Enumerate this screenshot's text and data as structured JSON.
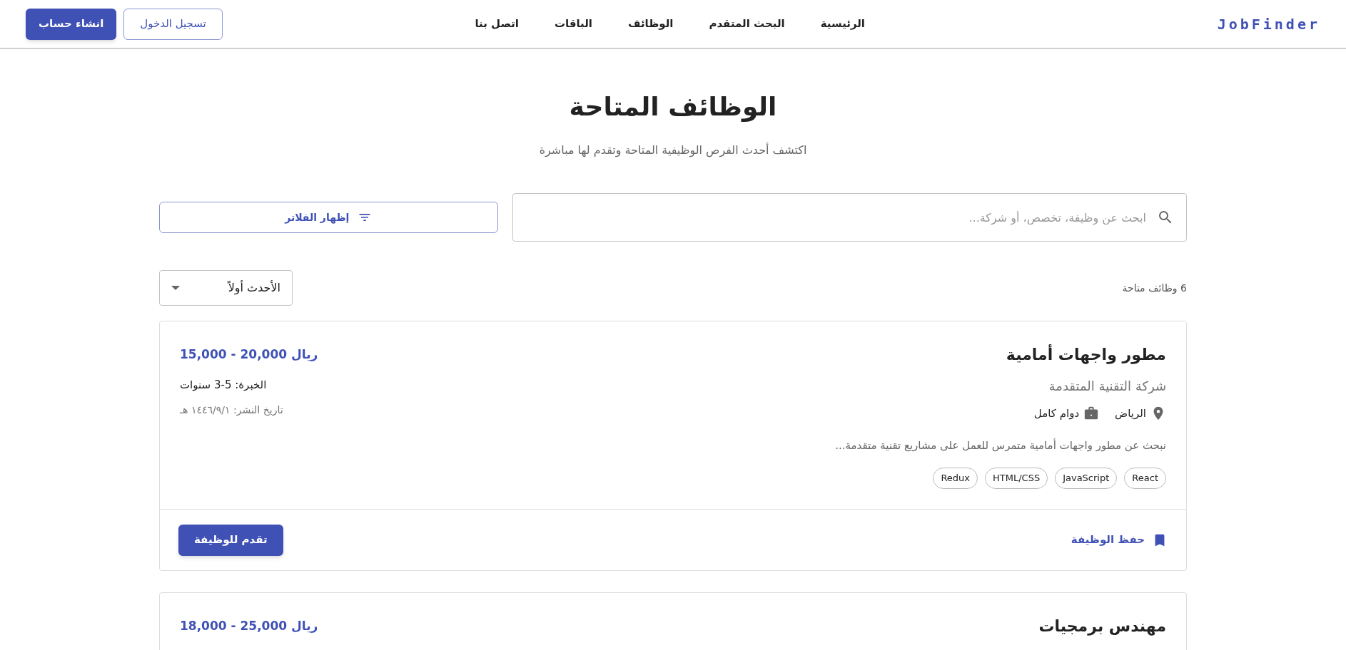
{
  "header": {
    "logo": "JobFinder",
    "nav": [
      "الرئيسية",
      "البحث المتقدم",
      "الوظائف",
      "الباقات",
      "اتصل بنا"
    ],
    "login_button": "تسجيل الدخول",
    "signup_button": "انشاء حساب"
  },
  "page": {
    "title": "الوظائف المتاحة",
    "subtitle": "اكتشف أحدث الفرص الوظيفية المتاحة وتقدم لها مباشرة"
  },
  "search": {
    "placeholder": "ابحث عن وظيفة، تخصص، أو شركة..."
  },
  "filter_button": "إظهار الفلاتر",
  "results_count": "6 وظائف متاحة",
  "sort": {
    "value": "الأحدث أولاً"
  },
  "jobs": [
    {
      "title": "مطور واجهات أمامية",
      "company": "شركة التقنية المتقدمة",
      "location": "الرياض",
      "type": "دوام كامل",
      "description": "نبحث عن مطور واجهات أمامية متمرس للعمل على مشاريع تقنية متقدمة...",
      "tags": [
        "React",
        "JavaScript",
        "HTML/CSS",
        "Redux"
      ],
      "salary": "15,000 - 20,000 ريال",
      "experience": "الخبرة: 5-3 سنوات",
      "posted": "تاريخ النشر: ١٤٤٦/٩/١ هـ",
      "save_label": "حفظ الوظيفة",
      "apply_label": "تقدم للوظيفة"
    },
    {
      "title": "مهندس برمجيات",
      "salary": "18,000 - 25,000 ريال"
    }
  ]
}
